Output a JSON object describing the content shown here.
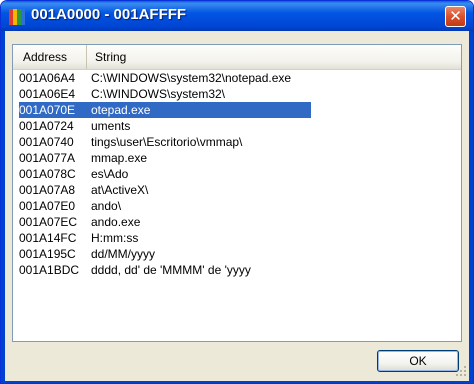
{
  "window": {
    "title": "001A0000 - 001AFFFF",
    "close_glyph": "✕"
  },
  "app_icon": {
    "name": "colorful-bars-icon",
    "colors": [
      "#e23b2e",
      "#f2b705",
      "#2b9a3b",
      "#2e6fd8"
    ]
  },
  "columns": {
    "address": "Address",
    "string": "String"
  },
  "rows": [
    {
      "address": "001A06A4",
      "string": "C:\\WINDOWS\\system32\\notepad.exe"
    },
    {
      "address": "001A06E4",
      "string": "C:\\WINDOWS\\system32\\"
    },
    {
      "address": "001A070E",
      "string": "otepad.exe"
    },
    {
      "address": "001A0724",
      "string": "uments"
    },
    {
      "address": "001A0740",
      "string": "tings\\user\\Escritorio\\vmmap\\"
    },
    {
      "address": "001A077A",
      "string": "mmap.exe"
    },
    {
      "address": "001A078C",
      "string": "es\\Ado"
    },
    {
      "address": "001A07A8",
      "string": "at\\ActiveX\\"
    },
    {
      "address": "001A07E0",
      "string": "ando\\"
    },
    {
      "address": "001A07EC",
      "string": "ando.exe"
    },
    {
      "address": "001A14FC",
      "string": "H:mm:ss"
    },
    {
      "address": "001A195C",
      "string": "dd/MM/yyyy"
    },
    {
      "address": "001A1BDC",
      "string": "dddd, dd' de 'MMMM' de 'yyyy"
    }
  ],
  "selected_row": 2,
  "buttons": {
    "ok": "OK"
  },
  "colors": {
    "titlebar": "#0255e3",
    "selection": "#316ac5",
    "dialog_bg": "#ece9d8"
  }
}
